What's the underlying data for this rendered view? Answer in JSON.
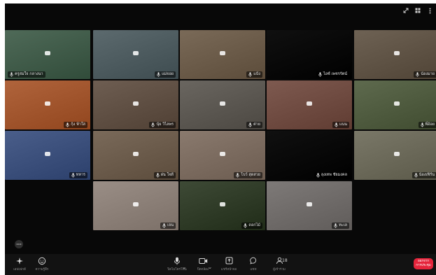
{
  "top_controls": [
    "expand-icon",
    "grid-view-icon",
    "more-options-icon"
  ],
  "tiles": [
    {
      "row": 0,
      "col": 0,
      "name": "ครูสมใจ กลางนา",
      "bg": "#4f6a58",
      "label_side": "left"
    },
    {
      "row": 0,
      "col": 1,
      "name": "แม่จอย",
      "bg": "#5c6a6e"
    },
    {
      "row": 0,
      "col": 2,
      "name": "แป้ง",
      "bg": "#7a6a58"
    },
    {
      "row": 0,
      "col": 3,
      "name": "ไอซ์ เพชรรัตน์",
      "bg": "#101010"
    },
    {
      "row": 0,
      "col": 4,
      "name": "น้องมาย",
      "bg": "#6e6254"
    },
    {
      "row": 1,
      "col": 0,
      "name": "กุ้ง ฟ้าใส",
      "bg": "#b0643c"
    },
    {
      "row": 1,
      "col": 1,
      "name": "นุ้ย วิไลพร",
      "bg": "#6e5e52"
    },
    {
      "row": 1,
      "col": 2,
      "name": "ต่าย",
      "bg": "#6a6660"
    },
    {
      "row": 1,
      "col": 3,
      "name": "แนน",
      "bg": "#7e5a50"
    },
    {
      "row": 1,
      "col": 4,
      "name": "พี่อ้อย",
      "bg": "#5e6a4e"
    },
    {
      "row": 2,
      "col": 0,
      "name": "ทหาร",
      "bg": "#4a5e8a"
    },
    {
      "row": 2,
      "col": 1,
      "name": "ฝน ใจดี",
      "bg": "#7a6a5a"
    },
    {
      "row": 2,
      "col": 2,
      "name": "โบว์ สุดสวย",
      "bg": "#8a7a6e"
    },
    {
      "row": 2,
      "col": 3,
      "name": "ลุงเทพ ชัยมงคล",
      "bg": "#101010"
    },
    {
      "row": 2,
      "col": 4,
      "name": "น้องเฟิร์น",
      "bg": "#7a7868"
    },
    {
      "row": 3,
      "col": 1,
      "name": "เจน",
      "bg": "#9a8e86"
    },
    {
      "row": 3,
      "col": 2,
      "name": "ดอกไม้",
      "bg": "#3e4a36"
    },
    {
      "row": 3,
      "col": 3,
      "name": "ทะเล",
      "bg": "#7e7a78"
    }
  ],
  "toolbar": {
    "effects_label": "เอฟเฟกต์",
    "reactions_label": "ความรู้สึก",
    "mic_label": "ปิดไมโครโฟน",
    "camera_label": "ปิดกล้อง",
    "share_label": "แชร์หน้าจอ",
    "chat_label": "แชท",
    "participants_label": "ผู้เข้าร่วม",
    "participants_count": "18",
    "leave_label_line1": "ออกจาก",
    "leave_label_line2": "การประชุม"
  },
  "colors": {
    "background": "#080808",
    "toolbar": "#121212",
    "leave": "#e5243b",
    "label_text": "#e8e8e8"
  }
}
